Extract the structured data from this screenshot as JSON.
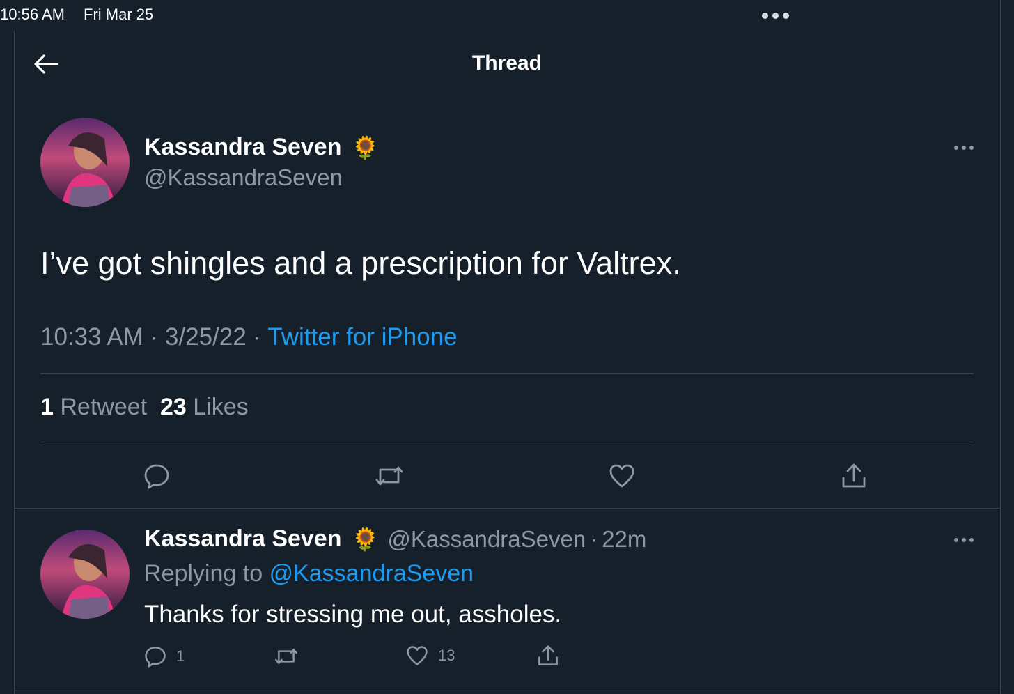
{
  "status_bar": {
    "time": "10:56 AM",
    "date": "Fri Mar 25"
  },
  "header": {
    "title": "Thread",
    "back_icon": "arrow-left-icon"
  },
  "main_tweet": {
    "author_name": "Kassandra Seven",
    "author_emoji": "🌻",
    "author_handle": "@KassandraSeven",
    "text": "I’ve got shingles and a prescription for Valtrex.",
    "time": "10:33 AM",
    "separator": "·",
    "date": "3/25/22",
    "source": "Twitter for iPhone",
    "retweet_count": "1",
    "retweet_label": "Retweet",
    "like_count": "23",
    "like_label": "Likes"
  },
  "reply_tweet": {
    "author_name": "Kassandra Seven",
    "author_emoji": "🌻",
    "author_handle": "@KassandraSeven",
    "separator": "·",
    "age": "22m",
    "replying_label": "Replying to",
    "replying_to": "@KassandraSeven",
    "text": "Thanks for stressing me out, assholes.",
    "reply_count": "1",
    "like_count": "13"
  },
  "colors": {
    "background": "#15202b",
    "text_primary": "#ffffff",
    "text_secondary": "#8b98a5",
    "accent": "#1d9bf0",
    "divider": "#38444d"
  }
}
